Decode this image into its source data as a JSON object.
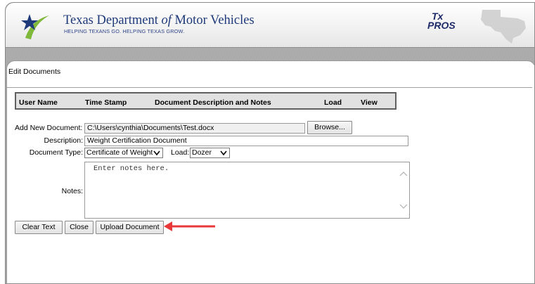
{
  "header": {
    "title_part1": "Texas Department ",
    "title_of": "of",
    "title_part2": " Motor Vehicles",
    "tagline": "HELPING TEXANS GO. HELPING TEXAS GROW.",
    "brand_line1": "Tx",
    "brand_line2": "PROS",
    "brand_color": "#1d2a68",
    "dept_color": "#1e3a7a",
    "star_color": "#1e3a7a",
    "swoosh_color": "#7fb83a"
  },
  "panel": {
    "title": "Edit Documents"
  },
  "table": {
    "columns": [
      "User Name",
      "Time Stamp",
      "Document Description and Notes",
      "Load",
      "View"
    ]
  },
  "form": {
    "add_label": "Add New Document:",
    "file_value": "C:\\Users\\cynthia\\Documents\\Test.docx",
    "browse_label": "Browse...",
    "description_label": "Description:",
    "description_value": "Weight Certification Document",
    "doc_type_label": "Document Type:",
    "doc_type_value": "Certificate of Weight",
    "load_label": "Load:",
    "load_value": "Dozer",
    "notes_label": "Notes:",
    "notes_placeholder": "Enter notes here."
  },
  "buttons": {
    "clear": "Clear Text",
    "close": "Close",
    "upload": "Upload Document"
  },
  "annotation": {
    "arrow_color": "#e8383a"
  }
}
